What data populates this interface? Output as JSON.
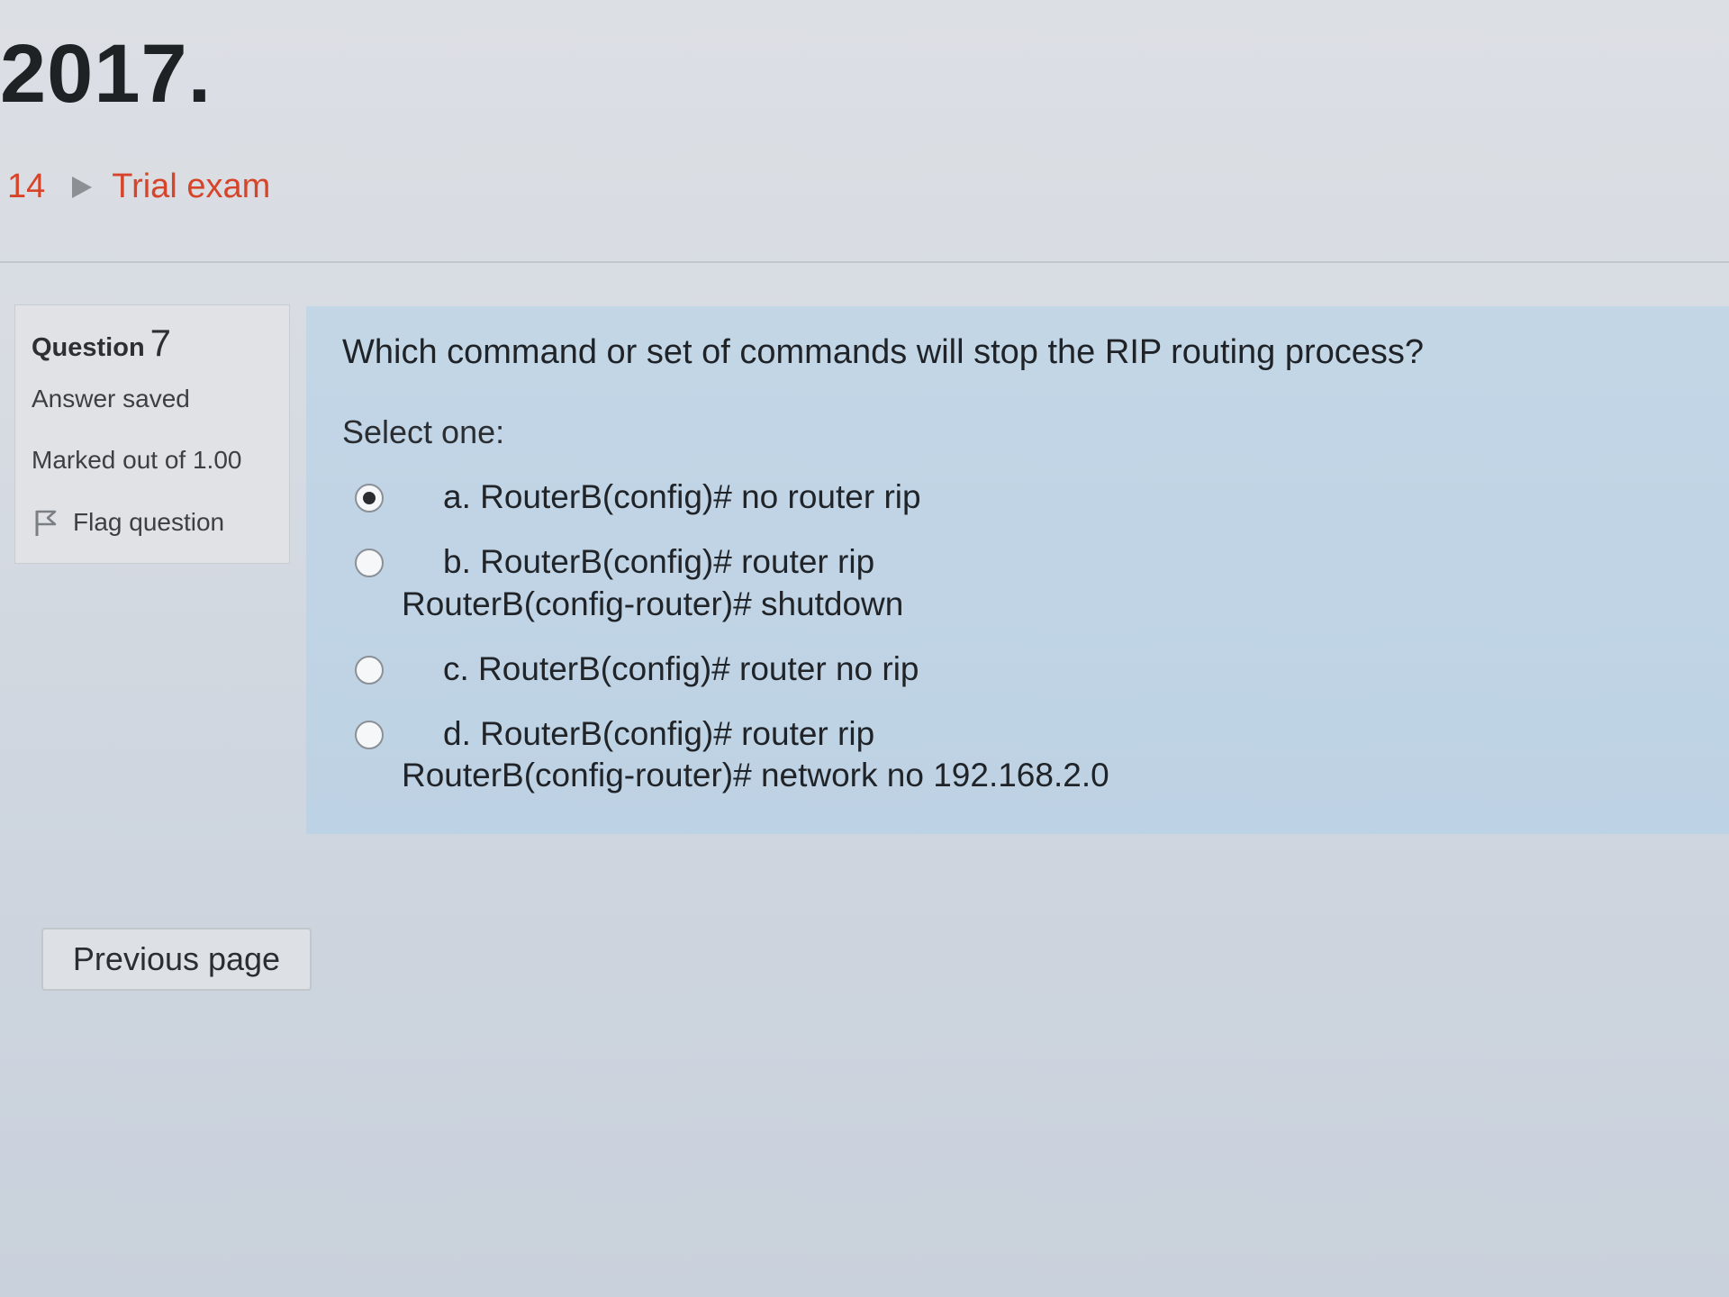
{
  "page": {
    "heading": "2017.",
    "breadcrumb": {
      "number": "14",
      "link": "Trial exam"
    }
  },
  "info": {
    "question_label": "Question",
    "question_number": "7",
    "status": "Answer saved",
    "marked": "Marked out of 1.00",
    "flag_label": "Flag question"
  },
  "question": {
    "text": "Which command or set of commands will stop the RIP routing process?",
    "prompt": "Select one:",
    "options": [
      {
        "line1": "a. RouterB(config)# no router rip",
        "line2": "",
        "selected": true
      },
      {
        "line1": "b. RouterB(config)# router rip",
        "line2": "RouterB(config-router)# shutdown",
        "selected": false
      },
      {
        "line1": "c. RouterB(config)# router no rip",
        "line2": "",
        "selected": false
      },
      {
        "line1": "d. RouterB(config)# router rip",
        "line2": "RouterB(config-router)# network no 192.168.2.0",
        "selected": false
      }
    ]
  },
  "nav": {
    "previous_label": "Previous page"
  },
  "colors": {
    "link": "#d6452a",
    "question_panel": "#c3d6e6",
    "info_panel": "#e0e2e5"
  },
  "icons": {
    "flag": "flag-icon",
    "breadcrumb_separator": "triangle-right-icon"
  }
}
